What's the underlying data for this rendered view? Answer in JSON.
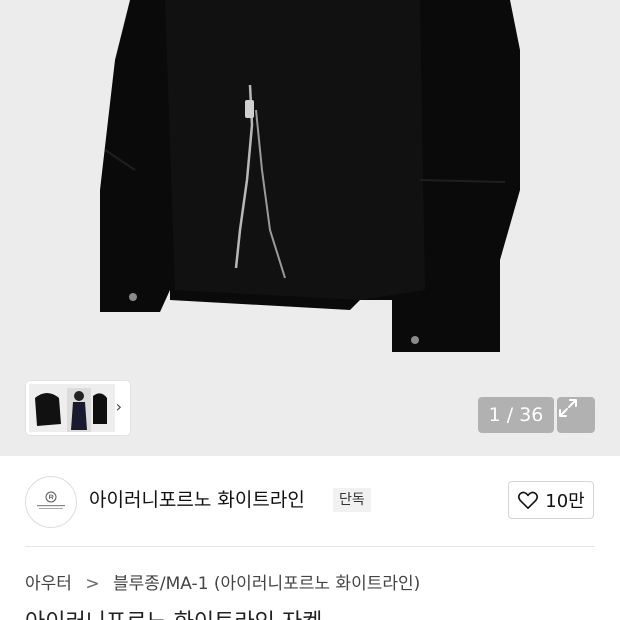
{
  "gallery": {
    "counter": "1 / 36",
    "thumbnail_next": "›"
  },
  "brand": {
    "name": "아이러니포르노 화이트라인",
    "badge": "단독",
    "logo_icon": "brand-logo-circle",
    "like_count": "10만"
  },
  "breadcrumb": {
    "items": [
      "아우터",
      "블루종/MA-1 (아이러니포르노 화이트라인)"
    ],
    "separator": ">"
  },
  "product_title_partial": "아이러니포르노 화이트라인 자켓"
}
